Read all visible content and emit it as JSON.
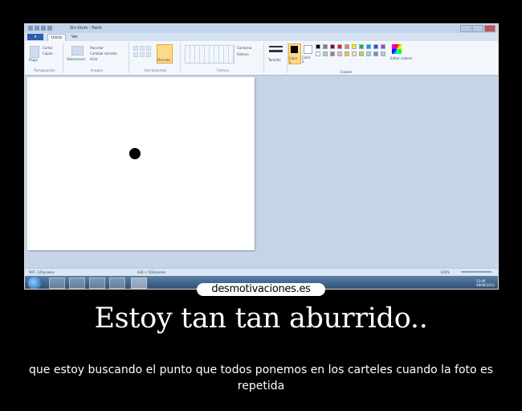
{
  "window": {
    "title": "Sin título - Paint",
    "tabs": [
      "Inicio",
      "Ver"
    ],
    "menu_label": "▾"
  },
  "ribbon": {
    "groups": [
      "Portapapeles",
      "Imagen",
      "Herramientas",
      "Formas",
      "Colores"
    ],
    "clipboard": {
      "paste": "Pegar",
      "cut": "Cortar",
      "copy": "Copiar"
    },
    "image": {
      "select": "Seleccionar",
      "crop": "Recortar",
      "resize": "Cambiar tamaño",
      "rotate": "Girar"
    },
    "tools": {
      "brushes": "Pinceles"
    },
    "shapes": {
      "outline": "Contorno",
      "fill": "Relleno"
    },
    "size": "Tamaño",
    "color1": "Color 1",
    "color2": "Color 2",
    "edit_colors": "Editar colores",
    "palette": [
      "#000000",
      "#7f7f7f",
      "#880015",
      "#ed1c24",
      "#ff7f27",
      "#fff200",
      "#22b14c",
      "#00a2e8",
      "#3f48cc",
      "#a349a4",
      "#ffffff",
      "#c3c3c3",
      "#b97a57",
      "#ffaec9",
      "#ffc90e",
      "#efe4b0",
      "#b5e61d",
      "#99d9ea",
      "#7092be",
      "#c8bfe7"
    ]
  },
  "status": {
    "cursor": "997, 225píxeles",
    "size": "636 × 502píxeles",
    "zoom": "100%"
  },
  "taskbar": {
    "time": "13:49",
    "date": "08/08/2012"
  },
  "logo": "desmotivaciones.es",
  "heading": "Estoy tan tan aburrido..",
  "caption": "que estoy buscando el punto que todos ponemos en los carteles cuando la foto es repetida"
}
